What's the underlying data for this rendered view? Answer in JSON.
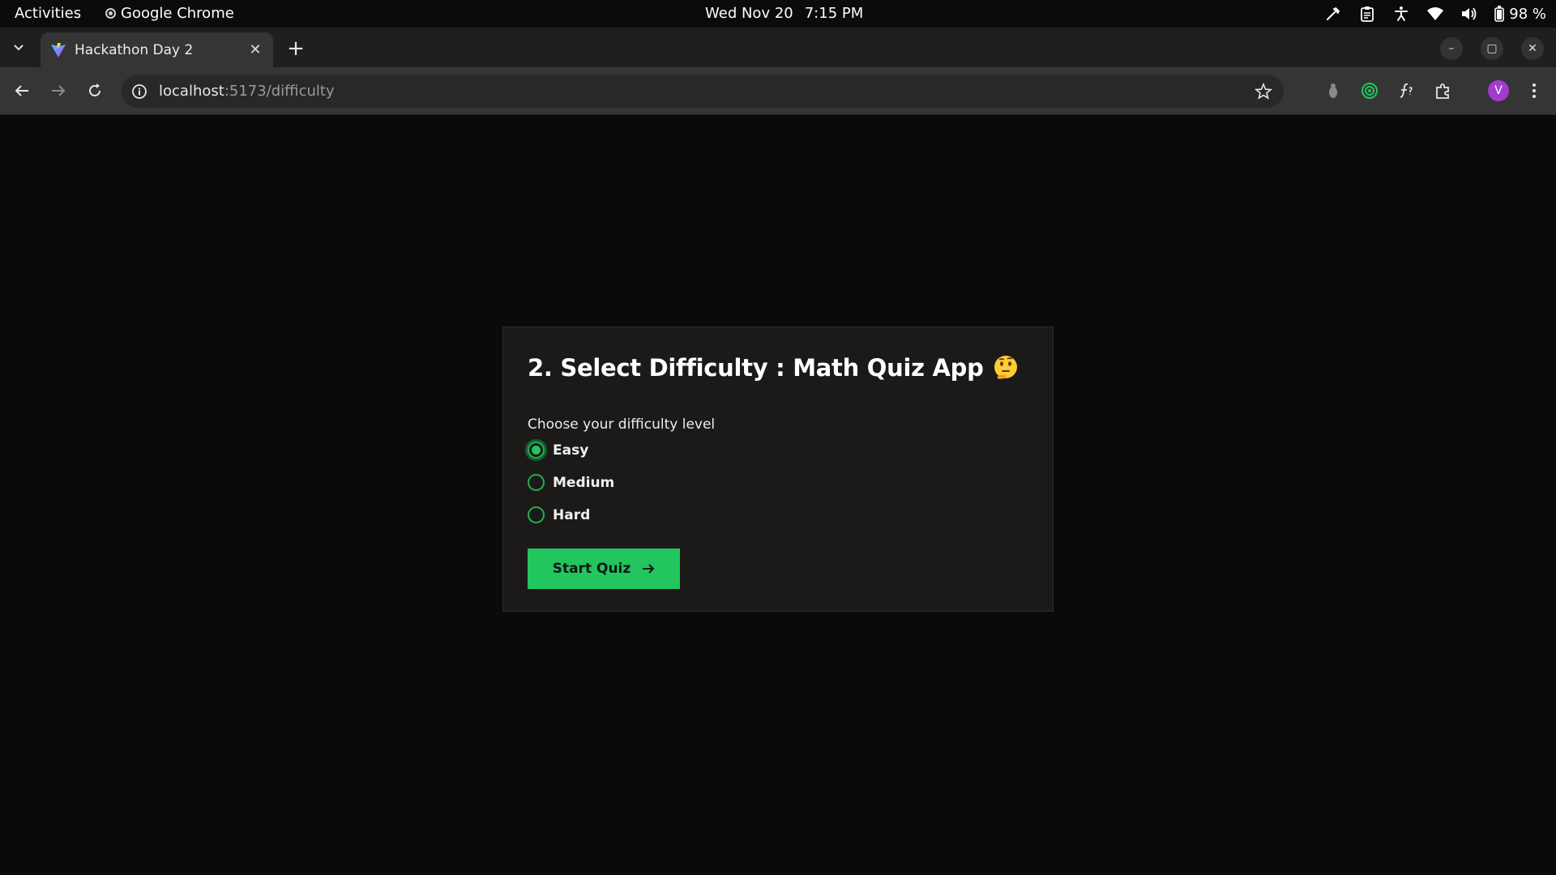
{
  "system_bar": {
    "activities": "Activities",
    "app_name": "Google Chrome",
    "date": "Wed Nov 20",
    "time": "7:15 PM",
    "battery": "98 %"
  },
  "browser": {
    "tab_title": "Hackathon Day 2",
    "url_host": "localhost",
    "url_path": ":5173/difficulty",
    "avatar_letter": "V"
  },
  "quiz": {
    "heading": "2. Select Difficulty :  Math Quiz App",
    "prompt": "Choose your difficulty level",
    "options": [
      "Easy",
      "Medium",
      "Hard"
    ],
    "selected": "Easy",
    "start_label": "Start Quiz"
  },
  "colors": {
    "accent": "#22c55e",
    "card_bg": "#1c1a19",
    "page_bg": "#0a0a0a"
  }
}
